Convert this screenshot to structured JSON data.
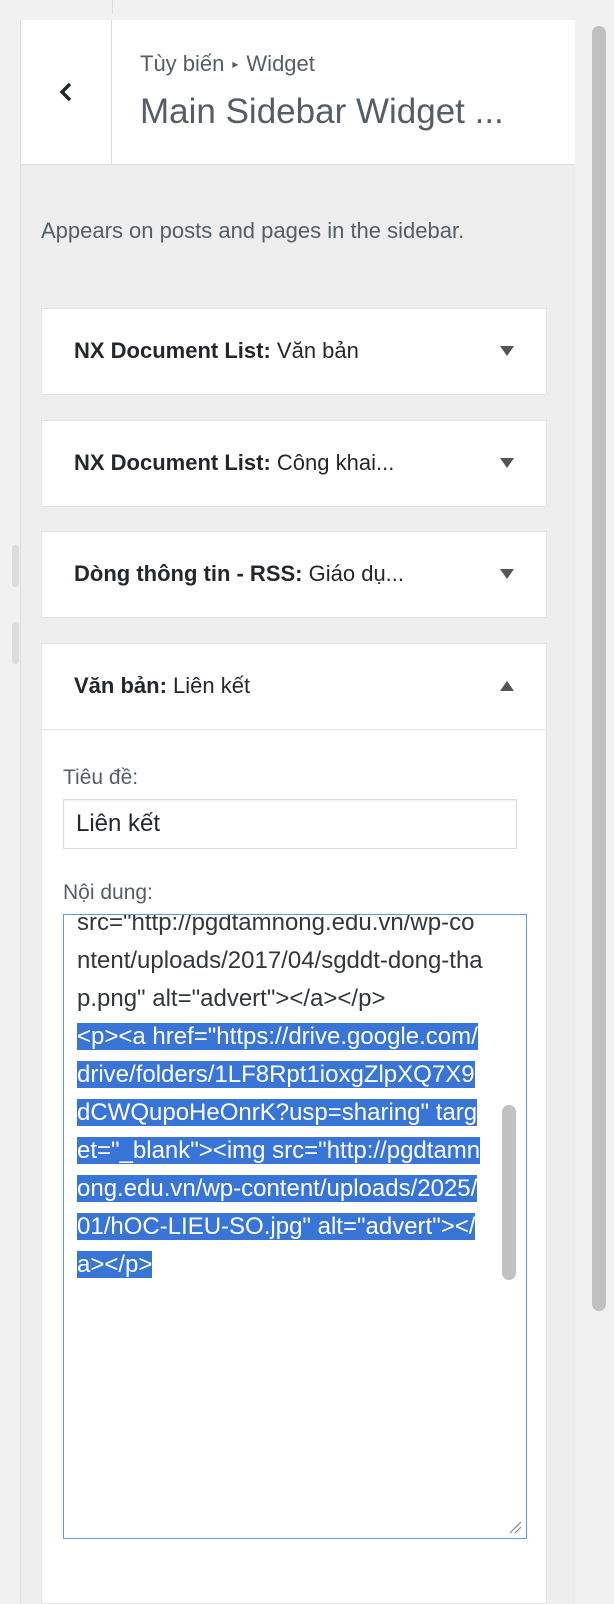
{
  "header": {
    "breadcrumb_root": "Tùy biến",
    "breadcrumb_sep": "▸",
    "breadcrumb_current": "Widget",
    "title": "Main Sidebar Widget ..."
  },
  "description": "Appears on posts and pages in the sidebar.",
  "widgets": [
    {
      "type": "NX Document List:",
      "name": "Văn bản",
      "expanded": false
    },
    {
      "type": "NX Document List:",
      "name": "Công khai...",
      "expanded": false
    },
    {
      "type": "Dòng thông tin - RSS:",
      "name": "Giáo dụ...",
      "expanded": false
    },
    {
      "type": "Văn bản:",
      "name": "Liên kết",
      "expanded": true
    }
  ],
  "form": {
    "title_label": "Tiêu đề:",
    "title_value": "Liên kết",
    "content_label": "Nội dung:",
    "content_lines": [
      "src=\"http://pgdtamnong.edu.vn/wp-content/uploads/2017/04/sgddt-dong-thap.png\" alt=\"advert\"></a></p>",
      "<p><a href=\"https://drive.google.com/drive/folders/1LF8Rpt1ioxgZlpXQ7X9dCWQupoHeOnrK?usp=sharing\" target=\"_blank\"><img src=\"http://pgdtamnong.edu.vn/wp-content/uploads/2025/01/hOC-LIEU-SO.jpg\" alt=\"advert\"></a></p>"
    ]
  },
  "colors": {
    "selection": "#3875d7",
    "focus_border": "#5b9dd9",
    "panel_bg": "#eeeeee"
  },
  "icons": {
    "back": "chevron-left-icon",
    "collapsed": "triangle-down-icon",
    "expanded": "triangle-up-icon"
  }
}
